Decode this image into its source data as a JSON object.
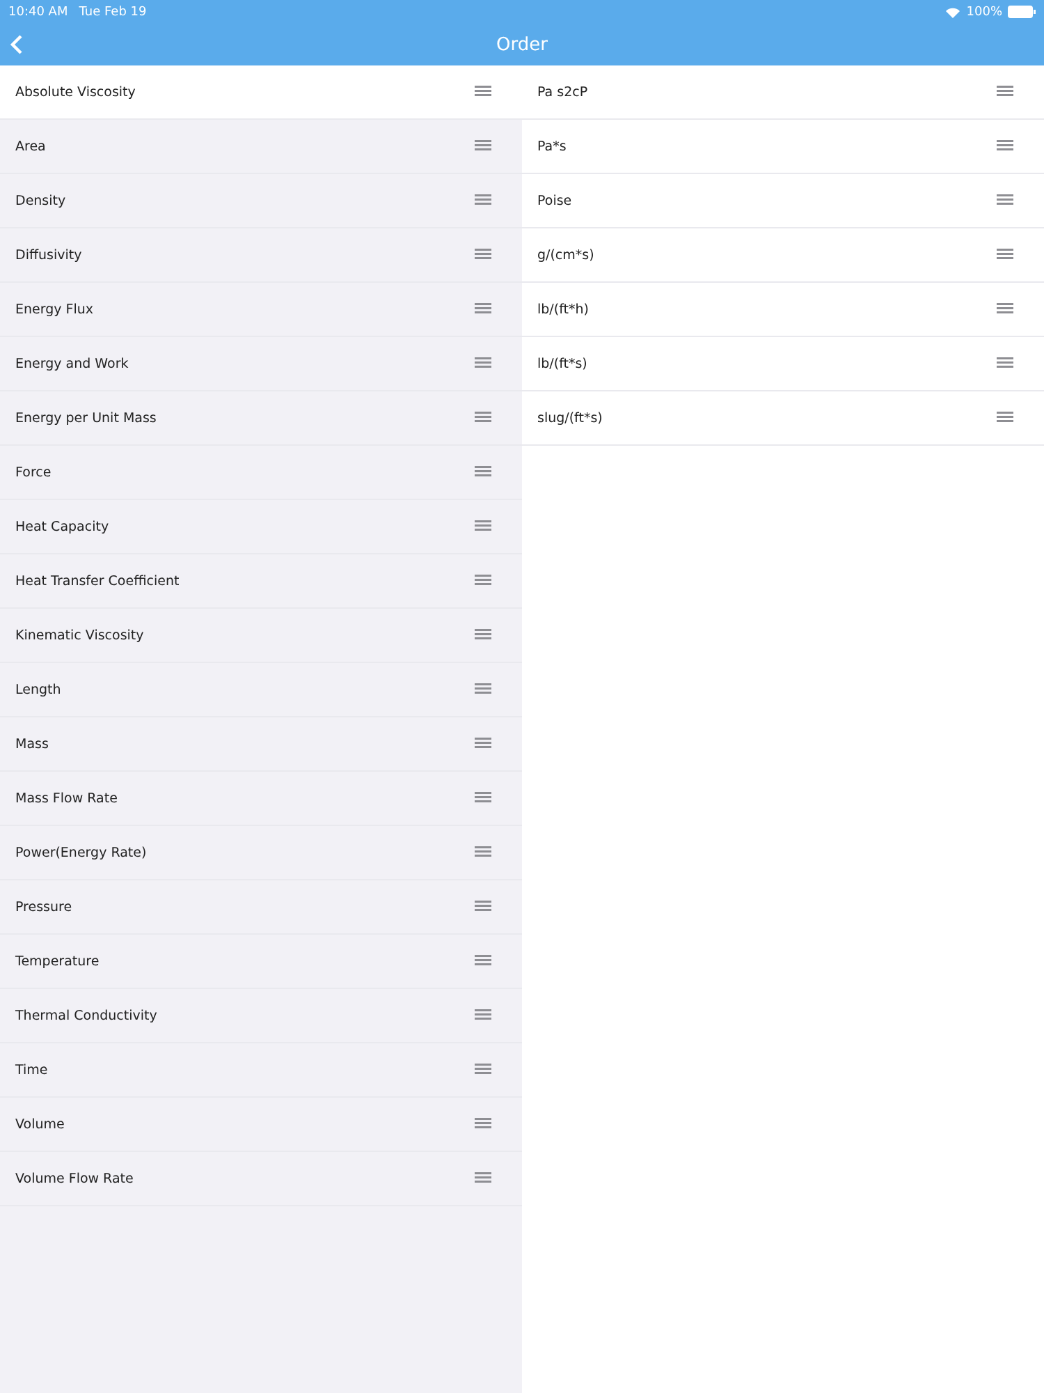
{
  "status_bar": {
    "time": "10:40 AM",
    "date": "Tue Feb 19",
    "battery": "100%"
  },
  "nav_bar": {
    "title": "Order"
  },
  "categories": [
    {
      "label": "Absolute Viscosity",
      "selected": true
    },
    {
      "label": "Area",
      "selected": false
    },
    {
      "label": "Density",
      "selected": false
    },
    {
      "label": "Diffusivity",
      "selected": false
    },
    {
      "label": "Energy Flux",
      "selected": false
    },
    {
      "label": "Energy and Work",
      "selected": false
    },
    {
      "label": "Energy per Unit Mass",
      "selected": false
    },
    {
      "label": "Force",
      "selected": false
    },
    {
      "label": "Heat Capacity",
      "selected": false
    },
    {
      "label": "Heat Transfer Coefficient",
      "selected": false
    },
    {
      "label": "Kinematic Viscosity",
      "selected": false
    },
    {
      "label": "Length",
      "selected": false
    },
    {
      "label": "Mass",
      "selected": false
    },
    {
      "label": "Mass Flow Rate",
      "selected": false
    },
    {
      "label": "Power(Energy Rate)",
      "selected": false
    },
    {
      "label": "Pressure",
      "selected": false
    },
    {
      "label": "Temperature",
      "selected": false
    },
    {
      "label": "Thermal Conductivity",
      "selected": false
    },
    {
      "label": "Time",
      "selected": false
    },
    {
      "label": "Volume",
      "selected": false
    },
    {
      "label": "Volume Flow Rate",
      "selected": false
    }
  ],
  "units": [
    {
      "label": "Pa s2cP"
    },
    {
      "label": "Pa*s"
    },
    {
      "label": "Poise"
    },
    {
      "label": "g/(cm*s)"
    },
    {
      "label": "lb/(ft*h)"
    },
    {
      "label": "lb/(ft*s)"
    },
    {
      "label": "slug/(ft*s)"
    }
  ]
}
